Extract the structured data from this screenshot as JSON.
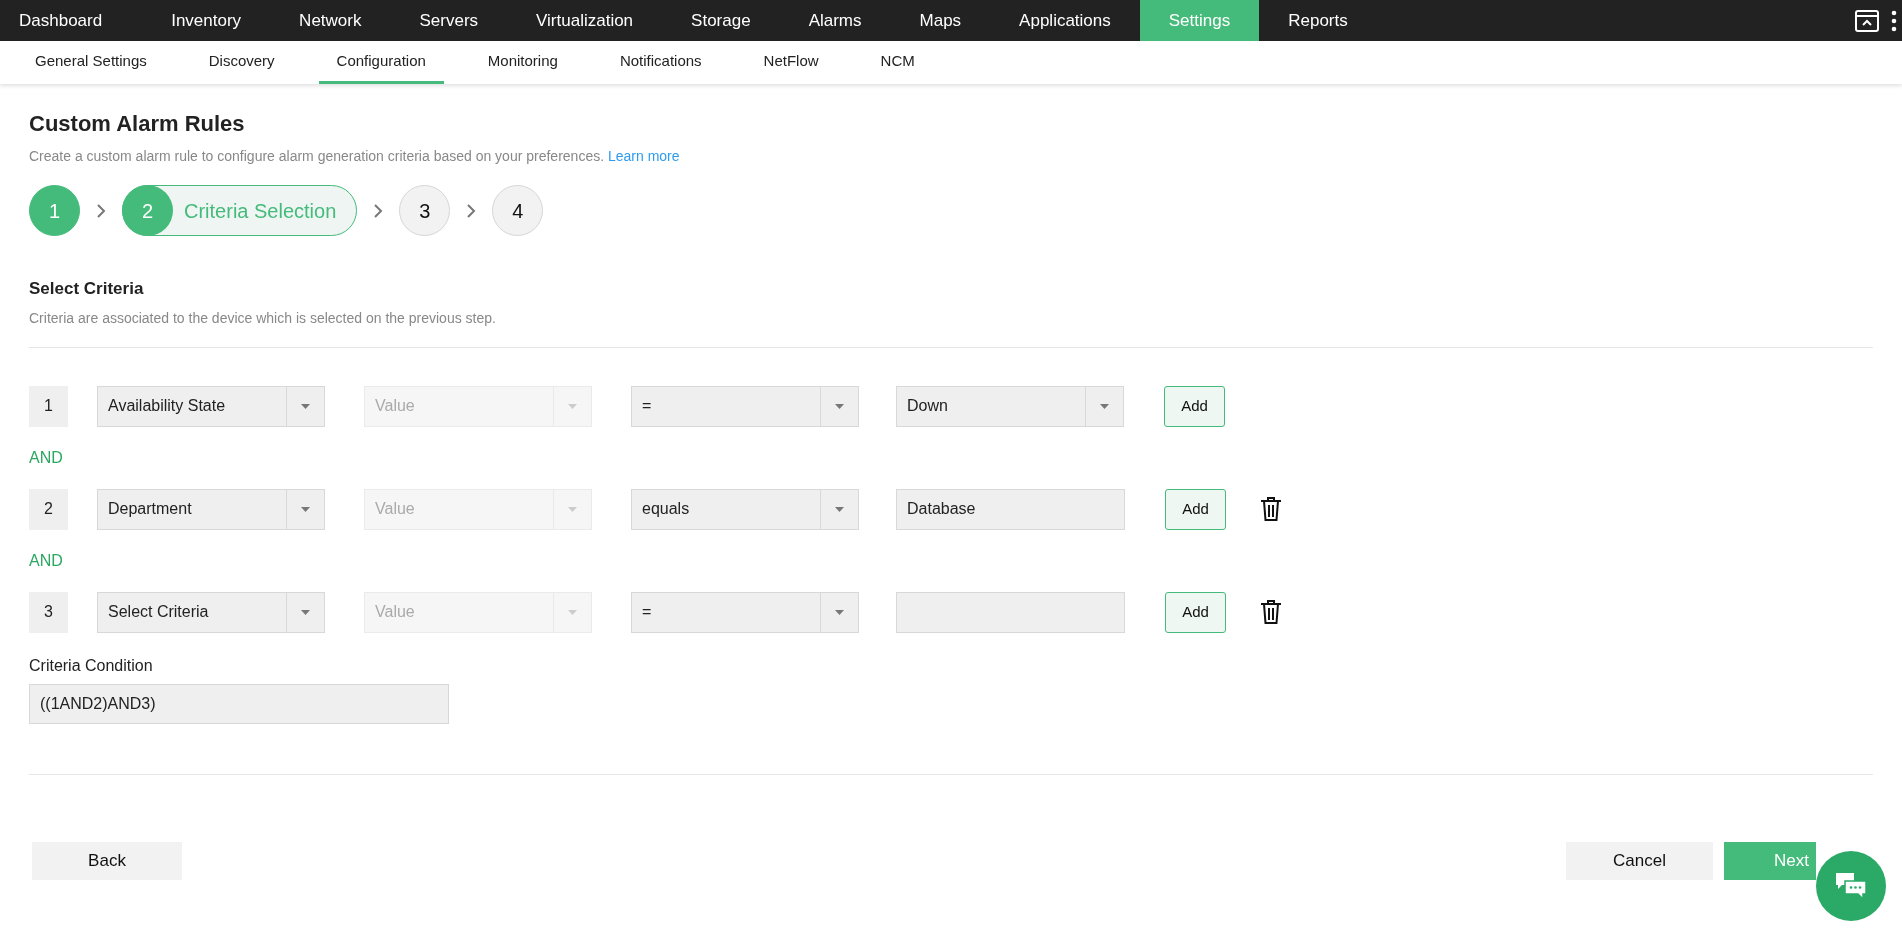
{
  "nav": [
    {
      "label": "Dashboard",
      "selected": false
    },
    {
      "label": "Inventory",
      "selected": false
    },
    {
      "label": "Network",
      "selected": false
    },
    {
      "label": "Servers",
      "selected": false
    },
    {
      "label": "Virtualization",
      "selected": false
    },
    {
      "label": "Storage",
      "selected": false
    },
    {
      "label": "Alarms",
      "selected": false
    },
    {
      "label": "Maps",
      "selected": false
    },
    {
      "label": "Applications",
      "selected": false
    },
    {
      "label": "Settings",
      "selected": true
    },
    {
      "label": "Reports",
      "selected": false
    }
  ],
  "subnav": [
    {
      "label": "General Settings",
      "selected": false
    },
    {
      "label": "Discovery",
      "selected": false
    },
    {
      "label": "Configuration",
      "selected": true
    },
    {
      "label": "Monitoring",
      "selected": false
    },
    {
      "label": "Notifications",
      "selected": false
    },
    {
      "label": "NetFlow",
      "selected": false
    },
    {
      "label": "NCM",
      "selected": false
    }
  ],
  "page": {
    "title": "Custom Alarm Rules",
    "description": "Create a custom alarm rule to configure alarm generation criteria based on your preferences.",
    "link": "Learn more"
  },
  "steps": [
    {
      "number": "1",
      "kind": "done"
    },
    {
      "number": "2",
      "kind": "active",
      "label": "Criteria Selection"
    },
    {
      "number": "3",
      "kind": "pending"
    },
    {
      "number": "4",
      "kind": "pending"
    }
  ],
  "section": {
    "title": "Select Criteria",
    "description": "Criteria are associated to the device which is selected on the previous step."
  },
  "criteria": [
    {
      "number": "1",
      "field": "Availability State",
      "value_placeholder": "Value",
      "value_disabled": true,
      "operator": "=",
      "target": {
        "kind": "dropdown",
        "text": "Down"
      },
      "add": "Add",
      "deletable": false,
      "connector": "AND"
    },
    {
      "number": "2",
      "field": "Department",
      "value_placeholder": "Value",
      "value_disabled": true,
      "operator": "equals",
      "target": {
        "kind": "text",
        "text": "Database"
      },
      "add": "Add",
      "deletable": true,
      "connector": "AND"
    },
    {
      "number": "3",
      "field": "Select Criteria",
      "value_placeholder": "Value",
      "value_disabled": true,
      "operator": "=",
      "target": {
        "kind": "text"
      },
      "add": "Add",
      "deletable": true
    }
  ],
  "condition": {
    "label": "Criteria Condition",
    "value": "((1AND2)AND3)"
  },
  "buttons": {
    "back": "Back",
    "cancel": "Cancel",
    "next": "Next"
  }
}
